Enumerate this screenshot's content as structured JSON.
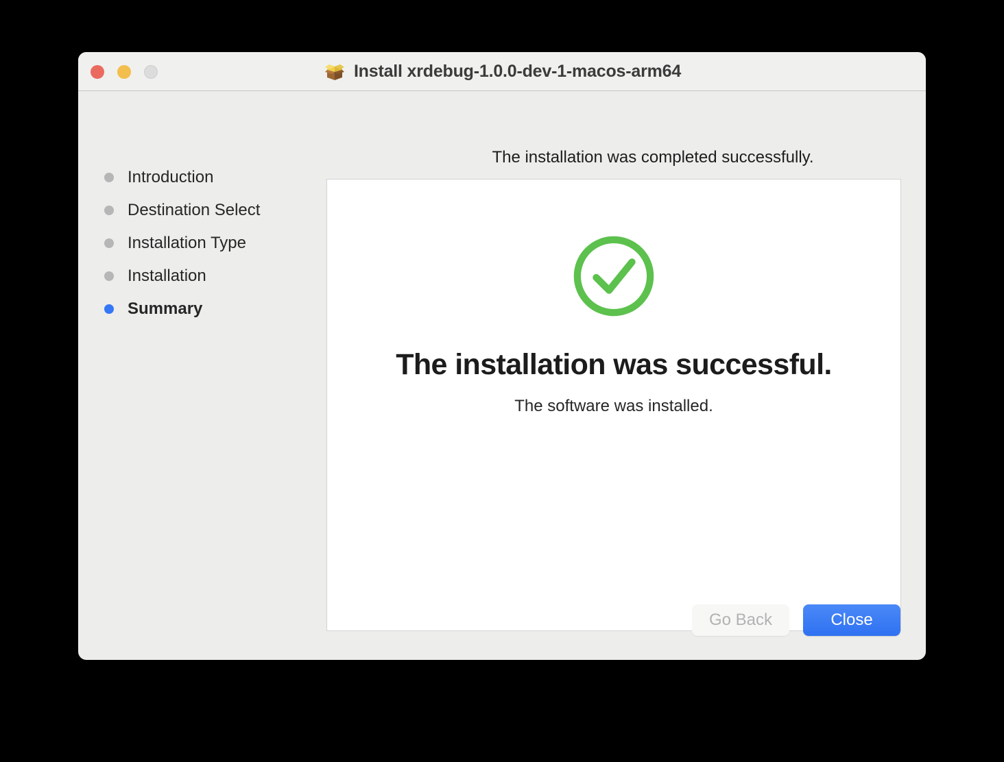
{
  "window": {
    "title": "Install xrdebug-1.0.0-dev-1-macos-arm64",
    "title_icon": "package-box-icon",
    "traffic_lights": {
      "close": "close-window-button",
      "minimize": "minimize-window-button",
      "zoom": "zoom-window-button"
    }
  },
  "sidebar": {
    "steps": [
      {
        "label": "Introduction",
        "active": false
      },
      {
        "label": "Destination Select",
        "active": false
      },
      {
        "label": "Installation Type",
        "active": false
      },
      {
        "label": "Installation",
        "active": false
      },
      {
        "label": "Summary",
        "active": true
      }
    ]
  },
  "main": {
    "headline": "The installation was completed successfully.",
    "status_icon": "success-check-circle-icon",
    "success_title": "The installation was successful.",
    "success_subtitle": "The software was installed."
  },
  "footer": {
    "go_back_label": "Go Back",
    "close_label": "Close"
  },
  "colors": {
    "accent_blue": "#3478f6",
    "primary_button": "#3b7ff5",
    "success_green": "#5cc14d",
    "traffic_close": "#ea6a5f",
    "traffic_min": "#f3be4d",
    "traffic_zoom": "#dcdcdc",
    "window_bg": "#ededeb",
    "titlebar_bg": "#f0f0ee"
  }
}
